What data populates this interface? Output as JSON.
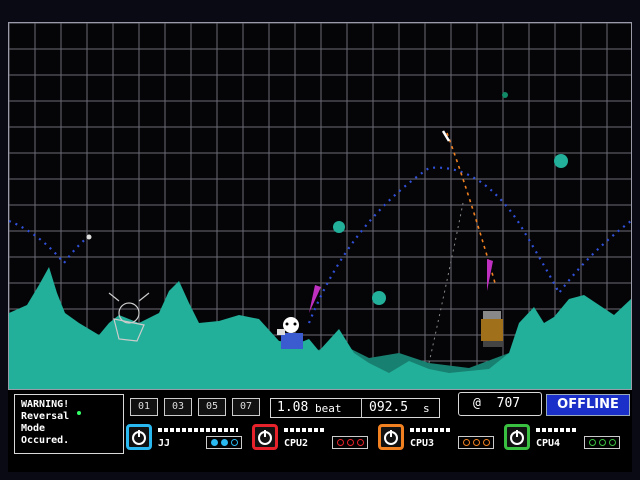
{
  "warning": {
    "lines": [
      "WARNING!",
      "Reversal",
      "Mode",
      "Occured."
    ]
  },
  "pages": [
    "01",
    "03",
    "05",
    "07"
  ],
  "beat": {
    "value": "1.08",
    "unit": "beat",
    "time": "092.5",
    "time_unit": "s"
  },
  "score": {
    "prefix": "@",
    "value": "707"
  },
  "status": "OFFLINE",
  "players": [
    {
      "name": "JJ",
      "color": "#2ab8f0",
      "lives_filled": 2
    },
    {
      "name": "CPU2",
      "color": "#e8222a",
      "lives_filled": 3
    },
    {
      "name": "CPU3",
      "color": "#f08020",
      "lives_filled": 3
    },
    {
      "name": "CPU4",
      "color": "#3ac040",
      "lives_filled": 3
    }
  ],
  "colors": {
    "terrain": "#22b09a",
    "terrain_dark": "#188070",
    "grid": "#6a6a74",
    "trajectory": "#3050d8"
  }
}
